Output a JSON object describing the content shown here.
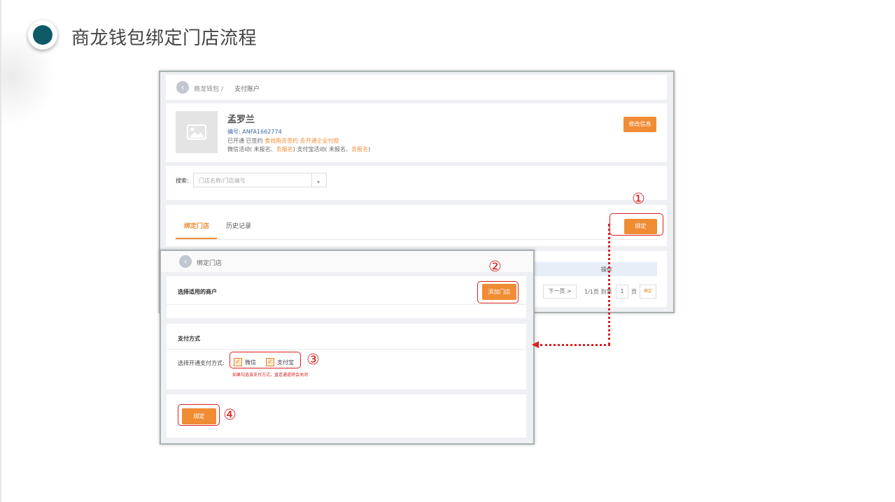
{
  "slide": {
    "title": "商龙钱包绑定门店流程"
  },
  "win1": {
    "breadcrumb": "商龙钱包 /",
    "breadcrumb2": "支付账户",
    "merchant_name": "孟罗兰",
    "merchant_id": "编号: ANFA1662774",
    "status_prefix": "已开通 已签约",
    "status_link1": "食尚购去签约",
    "status_link2": "去开通企业付款",
    "activity_prefix": "微信活动( 未报名、",
    "activity_link1": "去报名",
    "activity_mid": ") 支付宝活动( 未报名、",
    "activity_link2": "去报名",
    "activity_suffix": ")",
    "edit_button": "修改信息",
    "search_label": "搜索:",
    "search_placeholder": "门店名称/门店编号",
    "dropdown_arrow": "▾",
    "tab_bind": "绑定门店",
    "tab_history": "历史记录",
    "bind_button": "绑定",
    "table_op_header": "操作",
    "next_page": "下一页 >",
    "page_info": "1/1页 到第",
    "page_value": "1",
    "page_unit": "页",
    "confirm": "确定"
  },
  "win2": {
    "breadcrumb": "绑定门店",
    "section1_title": "选择适用的商户",
    "add_store_button": "添加门店",
    "section2_title": "支付方式",
    "pay_label": "选择开通支付方式:",
    "wechat": "微信",
    "alipay": "支付宝",
    "warning": "如果勾选该支付方式，直连通道将会关闭",
    "bind_button": "绑定"
  },
  "markers": {
    "m1": "①",
    "m2": "②",
    "m3": "③",
    "m4": "④"
  },
  "colors": {
    "accent": "#f08c34",
    "annotation": "#d92020",
    "bullet": "#0e5a66"
  }
}
